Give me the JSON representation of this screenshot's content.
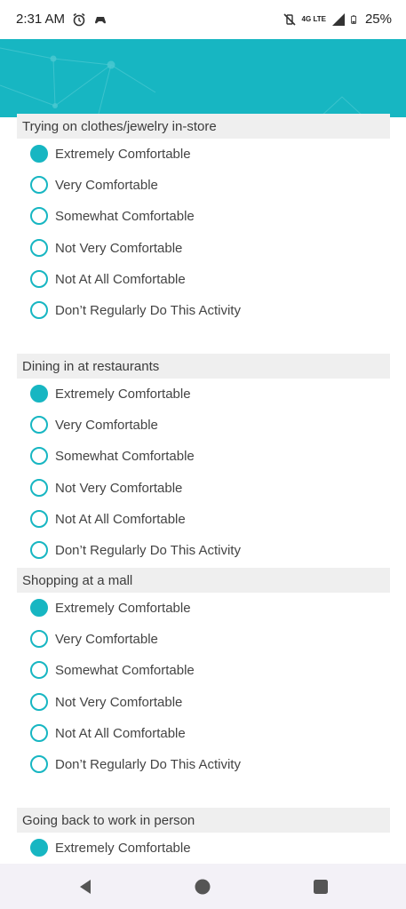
{
  "status_bar": {
    "time": "2:31 AM",
    "alarm_icon": "alarm-icon",
    "notification_icon": "game-controller-icon",
    "mute_icon": "vibrate-off-icon",
    "network": "4G LTE",
    "signal_icon": "signal-icon",
    "battery_icon": "battery-icon",
    "battery": "25%"
  },
  "theme": {
    "accent": "#17b6c2",
    "question_bg": "#efefef"
  },
  "questions": [
    {
      "label": "Trying on clothes/jewelry in-store",
      "options": [
        "Extremely Comfortable",
        "Very Comfortable",
        "Somewhat Comfortable",
        "Not Very Comfortable",
        "Not At All Comfortable",
        "Don’t Regularly Do This Activity"
      ],
      "selected": 0
    },
    {
      "label": "Dining in at restaurants",
      "options": [
        "Extremely Comfortable",
        "Very Comfortable",
        "Somewhat Comfortable",
        "Not Very Comfortable",
        "Not At All Comfortable",
        "Don’t Regularly Do This Activity"
      ],
      "selected": 0
    },
    {
      "label": "Shopping at a mall",
      "options": [
        "Extremely Comfortable",
        "Very Comfortable",
        "Somewhat Comfortable",
        "Not Very Comfortable",
        "Not At All Comfortable",
        "Don’t Regularly Do This Activity"
      ],
      "selected": 0
    },
    {
      "label": "Going back to work in person",
      "options": [
        "Extremely Comfortable"
      ],
      "selected": 0
    }
  ],
  "nav": {
    "back_icon": "back-icon",
    "home_icon": "home-icon",
    "recents_icon": "recents-icon"
  }
}
